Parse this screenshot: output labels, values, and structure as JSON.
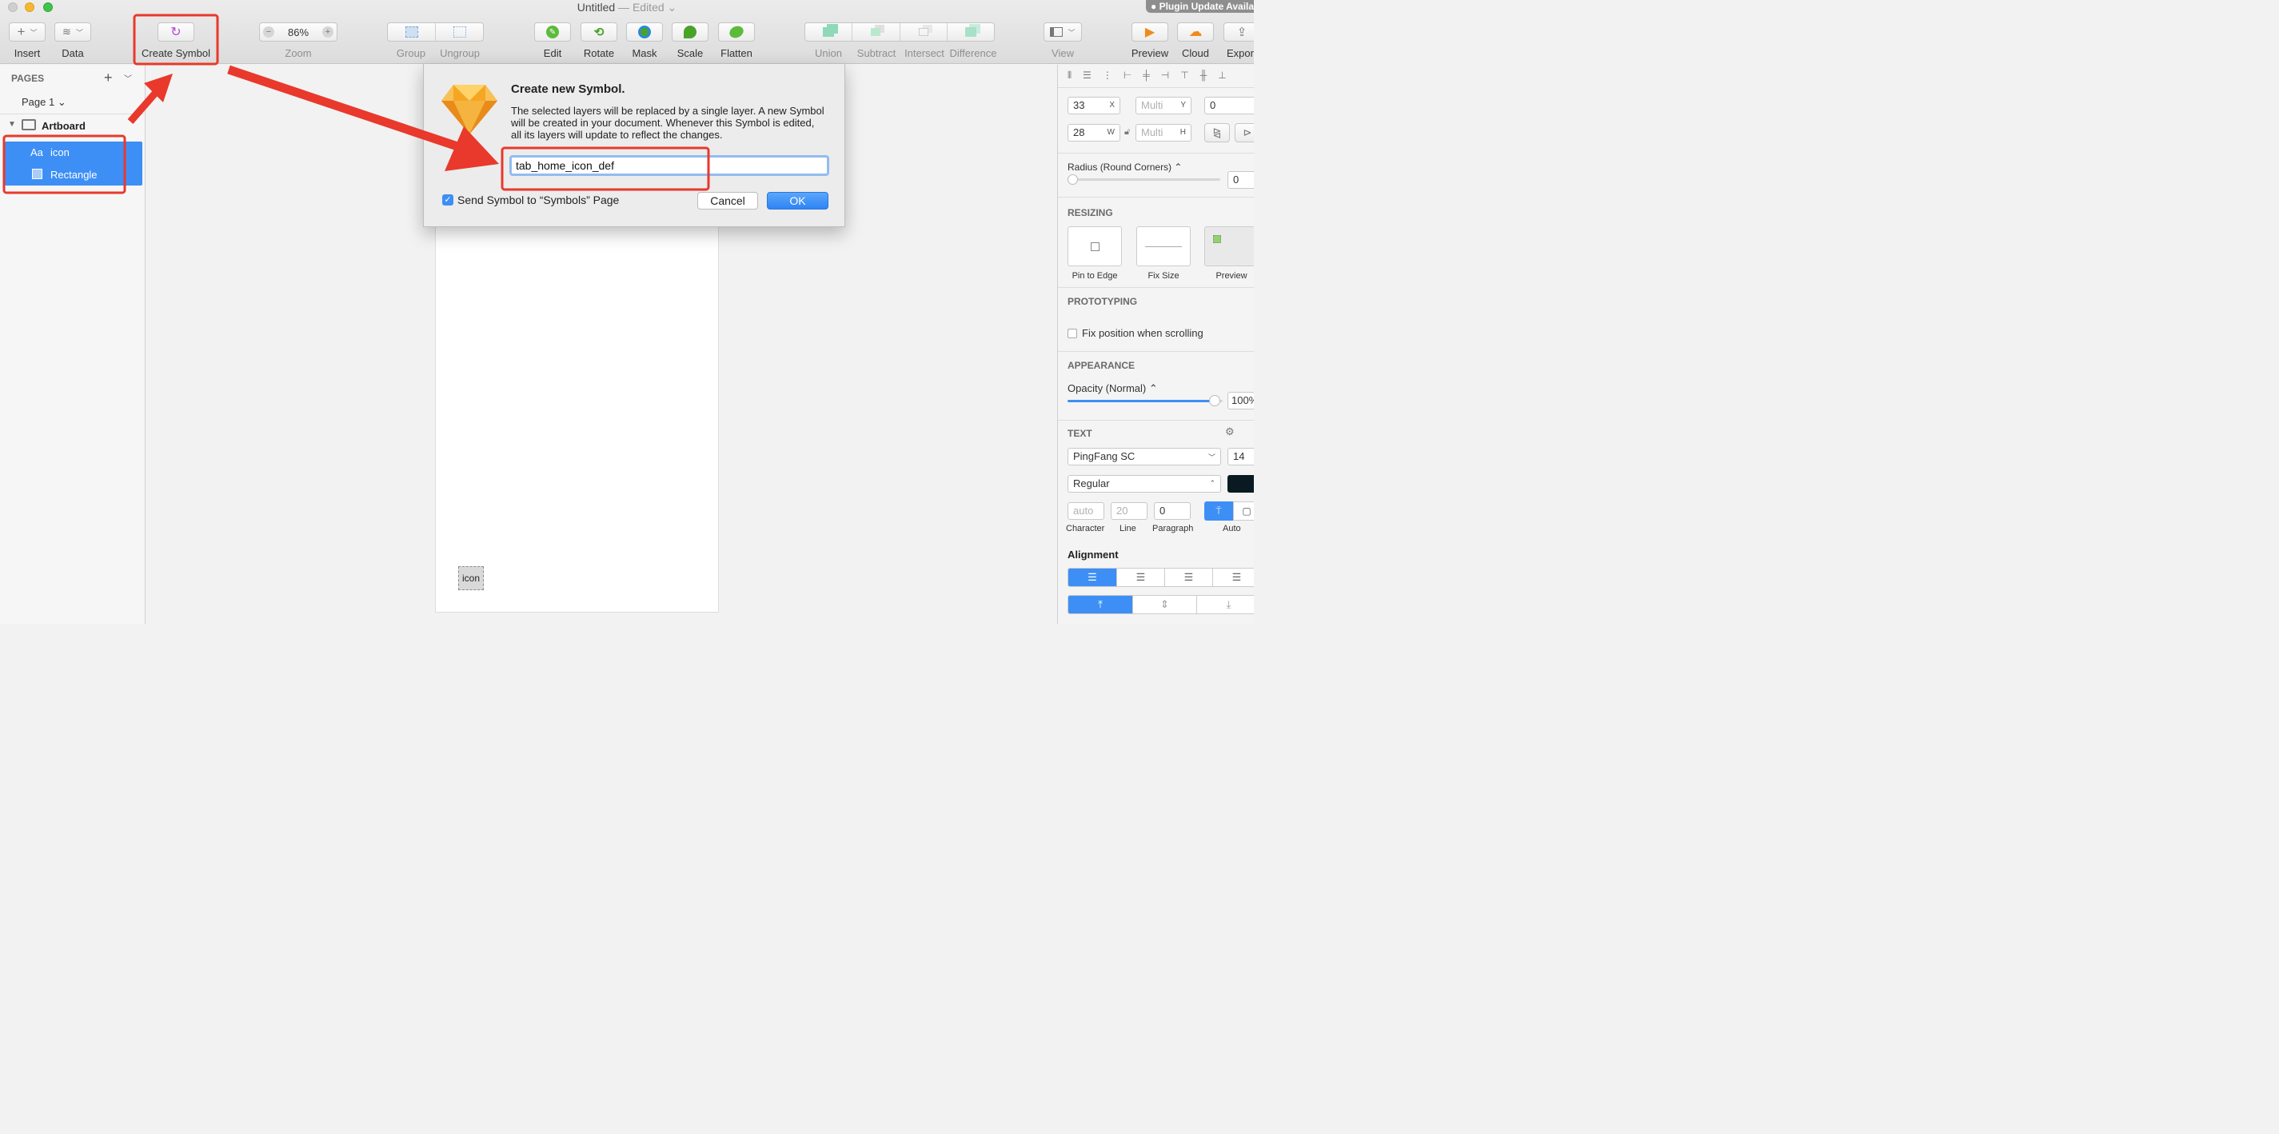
{
  "window": {
    "title": "Untitled",
    "edited": " — Edited ⌄",
    "plugin_notice": "● Plugin Update Available"
  },
  "toolbar": {
    "insert": "Insert",
    "data": "Data",
    "create_symbol": "Create Symbol",
    "zoom": "Zoom",
    "zoom_value": "86%",
    "group": "Group",
    "ungroup": "Ungroup",
    "edit": "Edit",
    "rotate": "Rotate",
    "mask": "Mask",
    "scale": "Scale",
    "flatten": "Flatten",
    "union": "Union",
    "subtract": "Subtract",
    "intersect": "Intersect",
    "difference": "Difference",
    "view": "View",
    "preview": "Preview",
    "cloud": "Cloud",
    "export": "Export"
  },
  "sidebar": {
    "pages_label": "PAGES",
    "page_selector": "Page 1 ⌄",
    "artboard": "Artboard",
    "layers": [
      {
        "icon_text": "Aa",
        "label": "icon"
      },
      {
        "icon_text": "",
        "label": "Rectangle"
      }
    ]
  },
  "canvas": {
    "selected_text": "icon"
  },
  "dialog": {
    "title": "Create new Symbol.",
    "body": "The selected layers will be replaced by a single layer. A new Symbol will be created in your document. Whenever this Symbol is edited, all its layers will update to reflect the changes.",
    "name_value": "tab_home_icon_def",
    "checkbox_label": "Send Symbol to “Symbols” Page",
    "checkbox_checked": true,
    "cancel": "Cancel",
    "ok": "OK"
  },
  "inspector": {
    "x": "33",
    "x_sfx": "X",
    "y": "Multi",
    "y_sfx": "Y",
    "r": "0",
    "w": "28",
    "w_sfx": "W",
    "h": "Multi",
    "h_sfx": "H",
    "radius_label": "Radius (Round Corners) ⌃",
    "radius_value": "0",
    "resizing": "RESIZING",
    "pin_to_edge": "Pin to Edge",
    "fix_size": "Fix Size",
    "preview": "Preview",
    "prototyping": "PROTOTYPING",
    "fix_position": "Fix position when scrolling",
    "appearance": "APPEARANCE",
    "opacity_label": "Opacity (Normal) ⌃",
    "opacity_value": "100%",
    "opacity": 0.95,
    "text": "TEXT",
    "font_family": "PingFang SC",
    "font_size": "14",
    "font_weight": "Regular",
    "character_value": "auto",
    "line_value": "20",
    "paragraph_value": "0",
    "character": "Character",
    "line": "Line",
    "paragraph": "Paragraph",
    "auto": "Auto",
    "alignment": "Alignment"
  },
  "colors": {
    "accent": "#3d8ff5",
    "annotation": "#e8392c",
    "diamond": "#f5a623"
  }
}
